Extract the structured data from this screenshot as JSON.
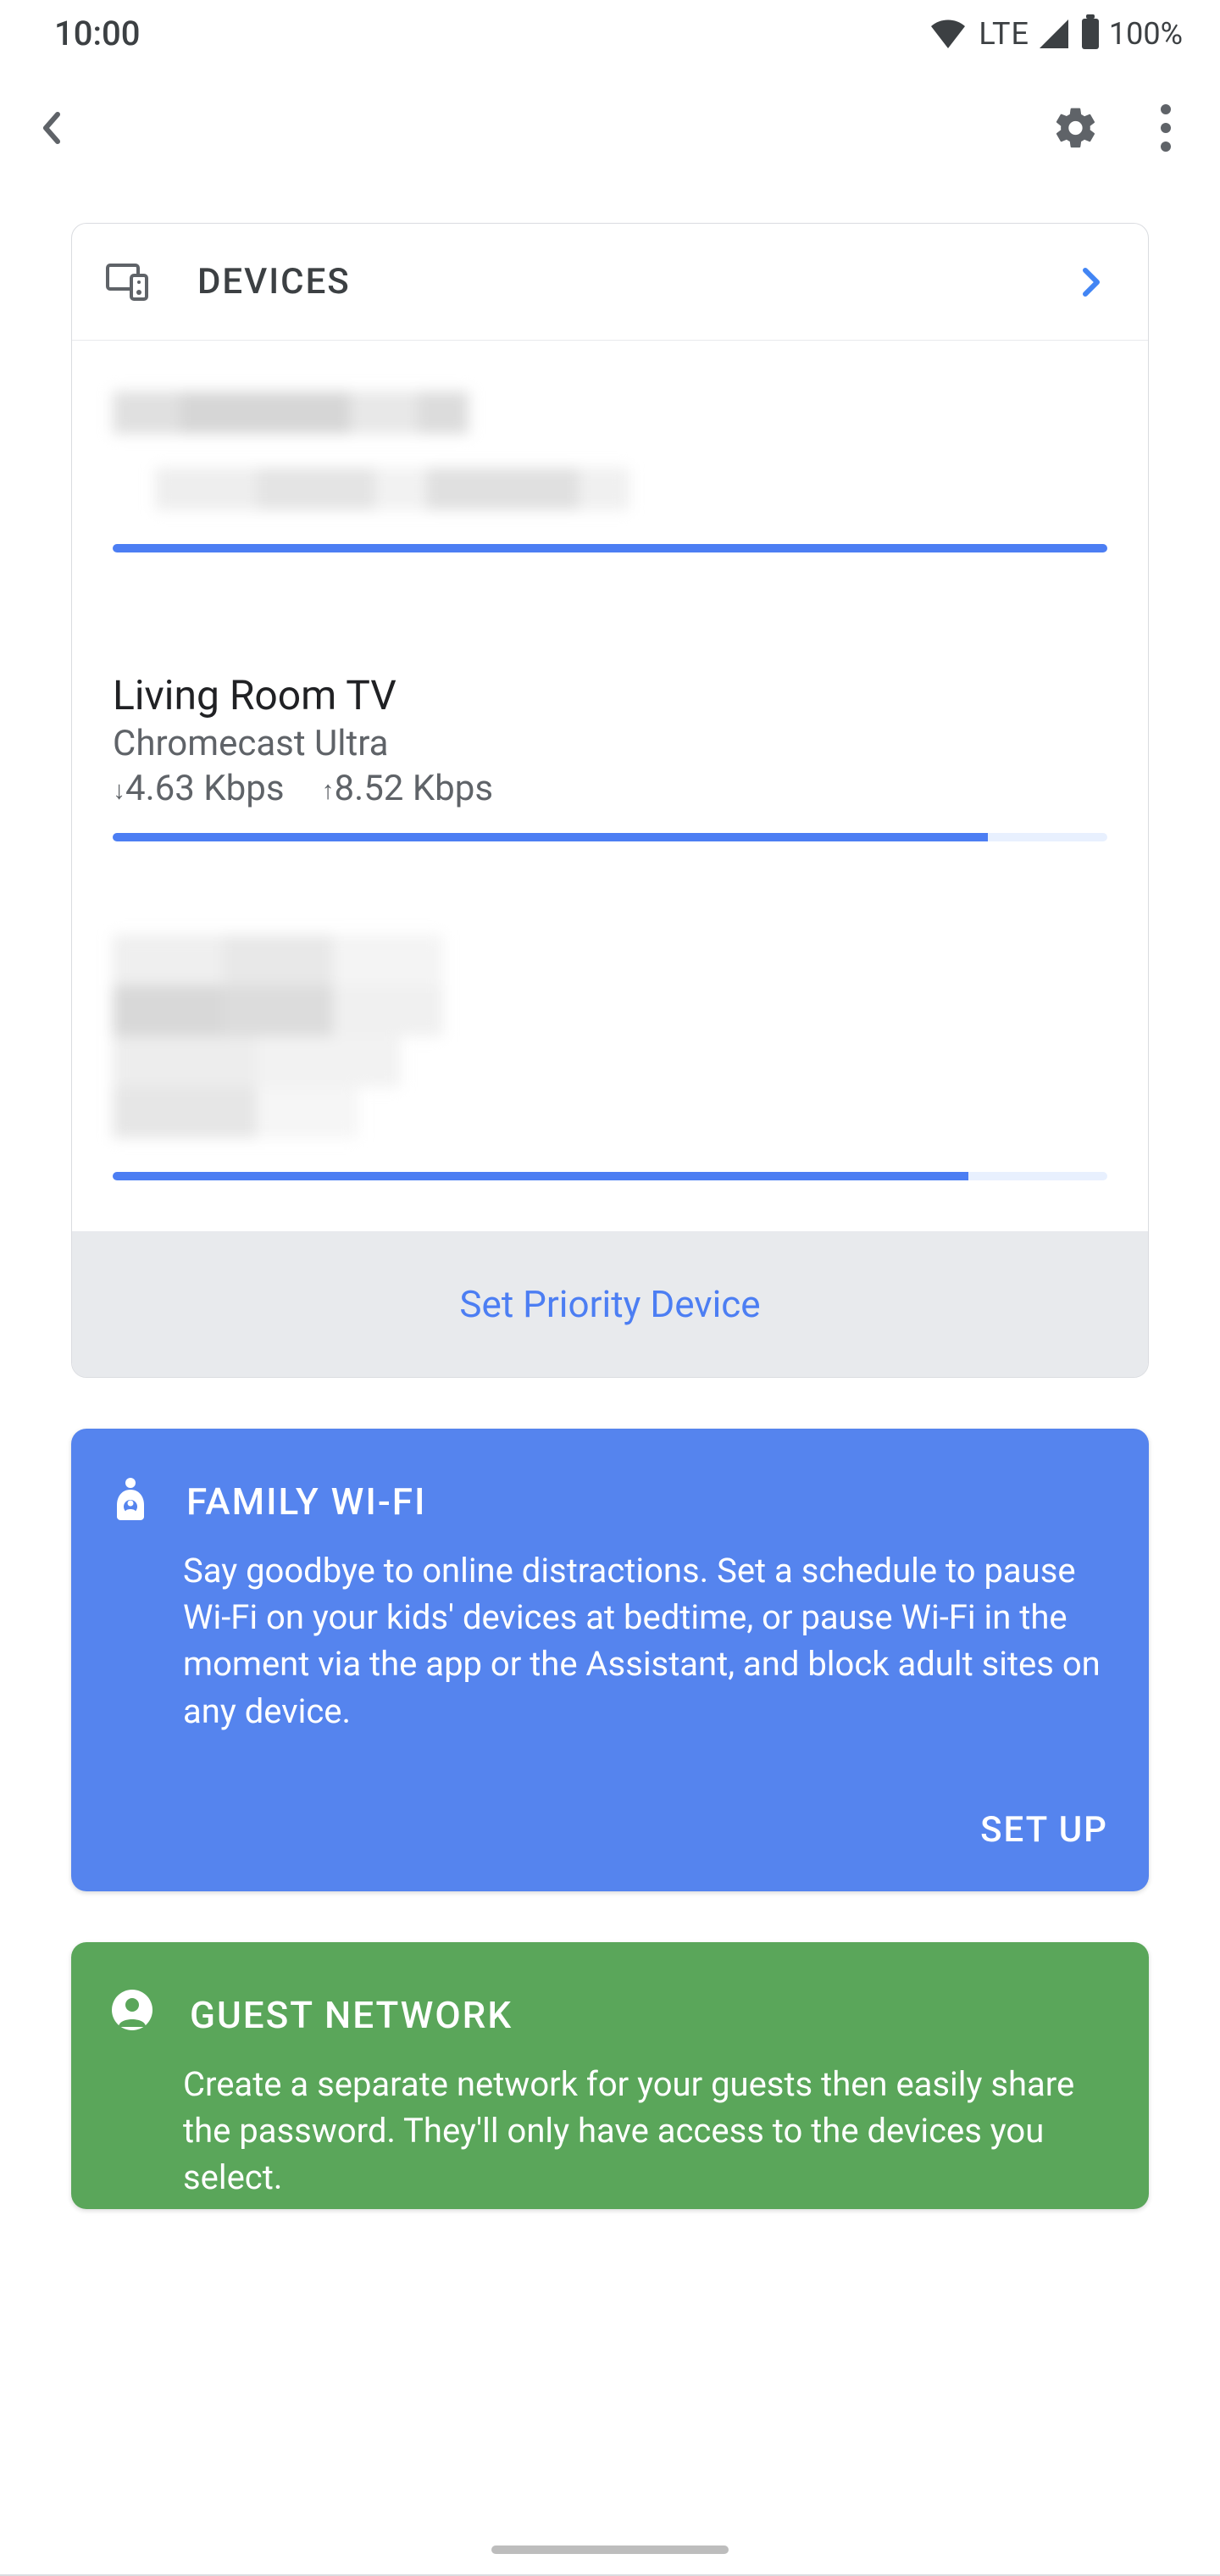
{
  "status": {
    "time": "10:00",
    "network_label": "LTE",
    "battery": "100%"
  },
  "devices_card": {
    "title": "DEVICES",
    "items": [
      {
        "name": "",
        "sub": "",
        "down": "",
        "up": "",
        "progress": 100,
        "redacted": true
      },
      {
        "name": "Living Room TV",
        "sub": "Chromecast Ultra",
        "down": "4.63 Kbps",
        "up": "8.52 Kbps",
        "progress": 88,
        "redacted": false
      },
      {
        "name": "",
        "sub": "",
        "down": "",
        "up": "",
        "progress": 86,
        "redacted": true
      }
    ],
    "footer_action": "Set Priority Device"
  },
  "family_card": {
    "title": "FAMILY WI-FI",
    "body": "Say goodbye to online distractions. Set a schedule to pause Wi-Fi on your kids' devices at bedtime, or pause Wi-Fi in the moment via the app or the Assistant, and block adult sites on any device.",
    "action": "SET UP"
  },
  "guest_card": {
    "title": "GUEST NETWORK",
    "body": "Create a separate network for your guests then easily share the password. They'll only have access to the devices you select."
  }
}
